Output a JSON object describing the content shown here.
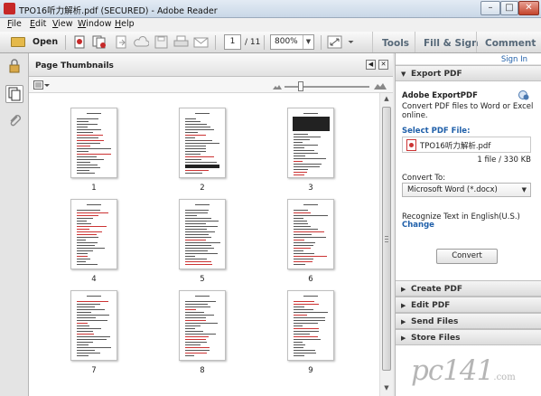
{
  "window": {
    "title": "TPO16听力解析.pdf (SECURED) - Adobe Reader",
    "minimize_glyph": "–",
    "maximize_glyph": "□",
    "close_glyph": "✕"
  },
  "menubar": {
    "items": [
      {
        "key": "F",
        "rest": "ile"
      },
      {
        "key": "E",
        "rest": "dit"
      },
      {
        "key": "V",
        "rest": "iew"
      },
      {
        "key": "W",
        "rest": "indow"
      },
      {
        "key": "H",
        "rest": "elp"
      }
    ]
  },
  "toolbar": {
    "open_label": "Open",
    "page_current": "1",
    "page_total": "/ 11",
    "zoom_value": "800%",
    "tools_label": "Tools",
    "fill_sign_label": "Fill & Sign",
    "comment_label": "Comment"
  },
  "thumbnails_pane": {
    "title": "Page Thumbnails",
    "pages": [
      "1",
      "2",
      "3",
      "4",
      "5",
      "6",
      "7",
      "8",
      "9"
    ]
  },
  "right_pane": {
    "sign_in": "Sign In",
    "export_pdf_header": "Export PDF",
    "export_title": "Adobe ExportPDF",
    "export_desc_line1": "Convert PDF files to Word or Excel",
    "export_desc_line2": "online.",
    "select_pdf_label": "Select PDF File:",
    "file_name": "TPO16听力解析.pdf",
    "file_info": "1 file / 330 KB",
    "convert_to_label": "Convert To:",
    "convert_to_value": "Microsoft Word (*.docx)",
    "recognize_text": "Recognize Text in English(U.S.)",
    "change_link": "Change",
    "convert_button": "Convert",
    "sections": [
      "Create PDF",
      "Edit PDF",
      "Send Files",
      "Store Files"
    ]
  },
  "watermark": {
    "text": "pc141",
    "suffix": ".com"
  },
  "colors": {
    "link_blue": "#1f5fa9",
    "pdf_red": "#c62828",
    "tab_text": "#566878"
  }
}
